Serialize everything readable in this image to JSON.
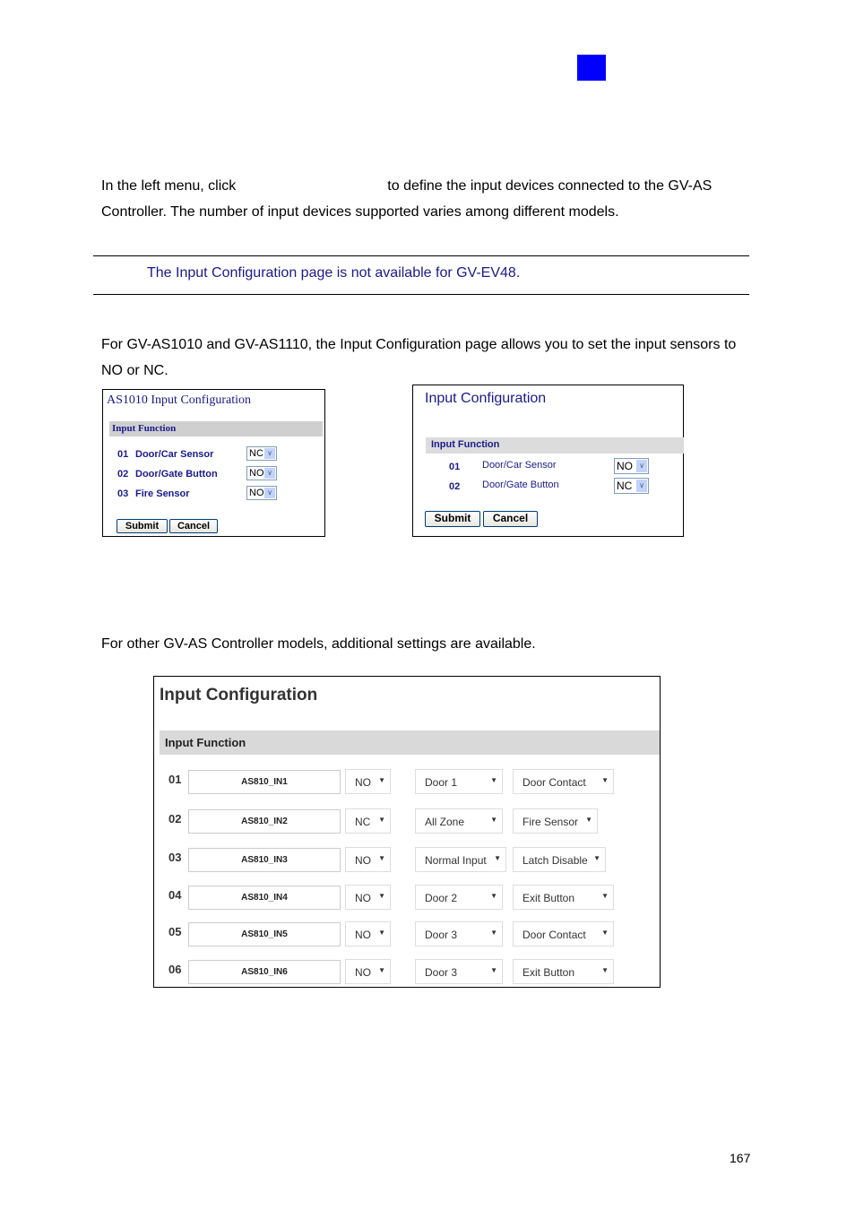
{
  "page": {
    "intro_part1": "In the left menu, click",
    "intro_part2": "to define the input devices connected to the GV-AS Controller. The number of input devices supported varies among different models.",
    "note": "The Input Configuration page is not available for GV-EV48.",
    "para_as1010": "For GV-AS1010 and GV-AS1110, the Input Configuration page allows you to set the input sensors to NO or NC.",
    "para_other": "For other GV-AS Controller models, additional settings are available.",
    "page_number": "167",
    "accent_color": "#0000ff"
  },
  "panel_as1010": {
    "title": "AS1010 Input Configuration",
    "section": "Input Function",
    "rows": [
      {
        "num": "01",
        "label": "Door/Car Sensor",
        "value": "NC"
      },
      {
        "num": "02",
        "label": "Door/Gate Button",
        "value": "NO"
      },
      {
        "num": "03",
        "label": "Fire Sensor",
        "value": "NO"
      }
    ],
    "submit": "Submit",
    "cancel": "Cancel"
  },
  "panel_as1110": {
    "title": "Input Configuration",
    "section": "Input Function",
    "rows": [
      {
        "num": "01",
        "label": "Door/Car Sensor",
        "value": "NO"
      },
      {
        "num": "02",
        "label": "Door/Gate Button",
        "value": "NC"
      }
    ],
    "submit": "Submit",
    "cancel": "Cancel"
  },
  "panel_other": {
    "title": "Input Configuration",
    "section": "Input Function",
    "rows": [
      {
        "num": "01",
        "name": "AS810_IN1",
        "state": "NO",
        "door": "Door 1",
        "function": "Door Contact"
      },
      {
        "num": "02",
        "name": "AS810_IN2",
        "state": "NC",
        "door": "All Zone",
        "function": "Fire Sensor"
      },
      {
        "num": "03",
        "name": "AS810_IN3",
        "state": "NO",
        "door": "Normal Input",
        "function": "Latch Disable"
      },
      {
        "num": "04",
        "name": "AS810_IN4",
        "state": "NO",
        "door": "Door 2",
        "function": "Exit Button"
      },
      {
        "num": "05",
        "name": "AS810_IN5",
        "state": "NO",
        "door": "Door 3",
        "function": "Door Contact"
      },
      {
        "num": "06",
        "name": "AS810_IN6",
        "state": "NO",
        "door": "Door 3",
        "function": "Exit Button"
      }
    ]
  }
}
